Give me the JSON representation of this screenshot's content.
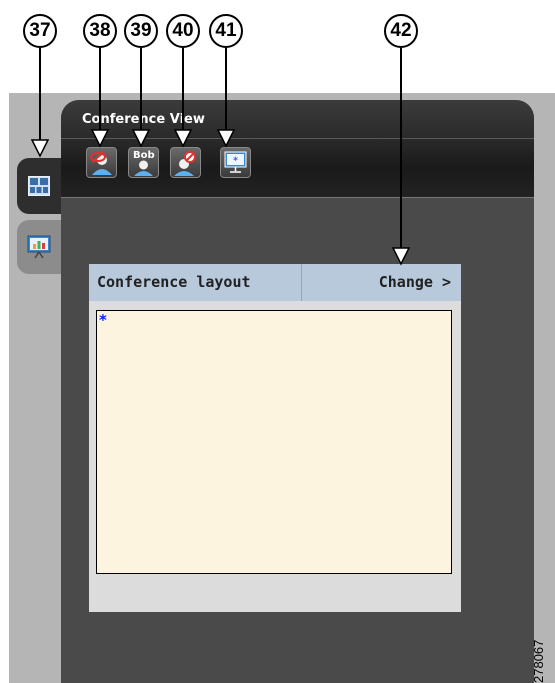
{
  "callouts": [
    "37",
    "38",
    "39",
    "40",
    "41",
    "42"
  ],
  "view": {
    "title": "Conference View"
  },
  "toolbar": {
    "buttons": [
      {
        "name": "mute-participant",
        "icon": "participant-muted-icon"
      },
      {
        "name": "participant-bob",
        "icon": "participant-bob-icon",
        "label": "Bob"
      },
      {
        "name": "remove-participant",
        "icon": "participant-remove-icon"
      },
      {
        "name": "presentation",
        "icon": "presentation-screen-icon"
      }
    ]
  },
  "side_tabs": [
    {
      "name": "conference-view-tab",
      "icon": "layout-grid-icon",
      "active": true
    },
    {
      "name": "presentation-tab",
      "icon": "presentation-chart-icon",
      "active": false
    }
  ],
  "layout_card": {
    "title": "Conference layout",
    "change_label": "Change >",
    "preview_marker": "*"
  },
  "figure_id": "278067",
  "colors": {
    "panel": "#4a4a4a",
    "card_header": "#b7c9db",
    "preview_bg": "#fdf4e0",
    "marker": "#0022ff"
  }
}
